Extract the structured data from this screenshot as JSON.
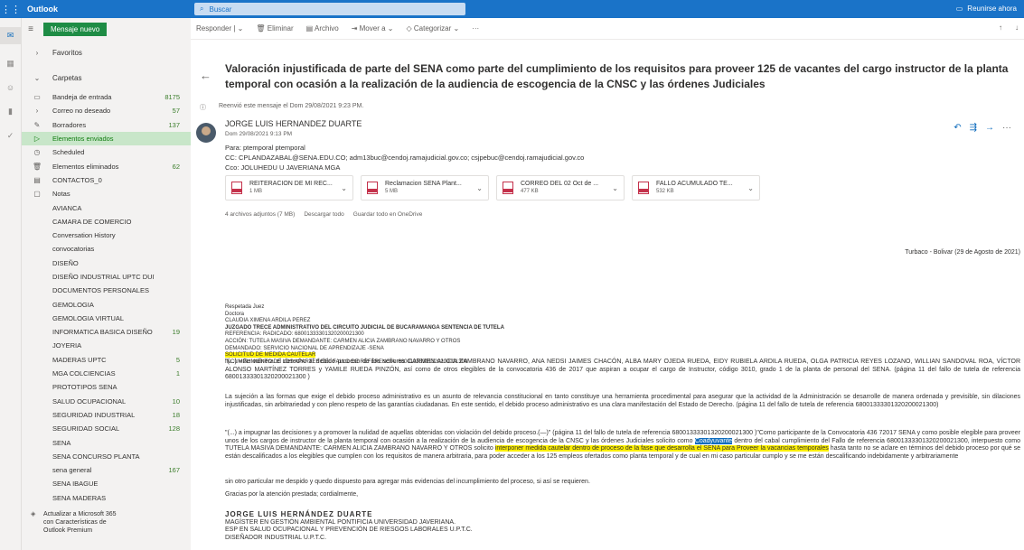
{
  "app": {
    "brand": "Outlook",
    "search_placeholder": "Buscar",
    "meet_now": "Reunirse ahora"
  },
  "folders": {
    "new_message": "Mensaje nuevo",
    "favorites": "Favoritos",
    "folders_label": "Carpetas",
    "items": [
      {
        "label": "Bandeja de entrada",
        "count": "8175",
        "icon": "inbox-icon"
      },
      {
        "label": "Correo no deseado",
        "count": "57",
        "icon": "chevron-right-icon"
      },
      {
        "label": "Borradores",
        "count": "137",
        "icon": "pencil-icon"
      },
      {
        "label": "Elementos enviados",
        "count": "",
        "icon": "send-icon"
      },
      {
        "label": "Scheduled",
        "count": "",
        "icon": "clock-icon"
      },
      {
        "label": "Elementos eliminados",
        "count": "62",
        "icon": "trash-icon"
      },
      {
        "label": "CONTACTOS_0",
        "count": "",
        "icon": "folder-icon"
      },
      {
        "label": "Notas",
        "count": "",
        "icon": "note-icon"
      },
      {
        "label": "AVIANCA",
        "count": ""
      },
      {
        "label": "CAMARA DE COMERCIO",
        "count": ""
      },
      {
        "label": "Conversation History",
        "count": ""
      },
      {
        "label": "convocatorias",
        "count": ""
      },
      {
        "label": "DISEÑO",
        "count": ""
      },
      {
        "label": "DISEÑO INDUSTRIAL UPTC DUITA...",
        "count": ""
      },
      {
        "label": "DOCUMENTOS PERSONALES",
        "count": ""
      },
      {
        "label": "GEMOLOGIA",
        "count": ""
      },
      {
        "label": "GEMOLOGIA VIRTUAL",
        "count": ""
      },
      {
        "label": "INFORMATICA BASICA DISEÑO ...",
        "count": "19"
      },
      {
        "label": "JOYERIA",
        "count": ""
      },
      {
        "label": "MADERAS UPTC",
        "count": "5"
      },
      {
        "label": "MGA COLCIENCIAS",
        "count": "1"
      },
      {
        "label": "PROTOTIPOS SENA",
        "count": ""
      },
      {
        "label": "SALUD OCUPACIONAL",
        "count": "10"
      },
      {
        "label": "SEGURIDAD INDUSTRIAL",
        "count": "18"
      },
      {
        "label": "SEGURIDAD SOCIAL",
        "count": "128"
      },
      {
        "label": "SENA",
        "count": ""
      },
      {
        "label": "SENA CONCURSO PLANTA",
        "count": ""
      },
      {
        "label": "sena general",
        "count": "167"
      },
      {
        "label": "SENA IBAGUE",
        "count": ""
      },
      {
        "label": "SENA MADERAS",
        "count": ""
      }
    ],
    "upgrade": [
      "Actualizar a Microsoft 365",
      "con Características de",
      "Outlook Premium"
    ]
  },
  "commands": {
    "reply": "Responder",
    "delete": "Eliminar",
    "archive": "Archivo",
    "move": "Mover a",
    "categorize": "Categorizar",
    "more": "···"
  },
  "message": {
    "subject": "Valoración injustificada de parte del SENA como parte del cumplimiento de los requisitos para proveer 125 de vacantes del cargo instructor de la planta temporal con ocasión a la realización de la audiencia de escogencia de la CNSC y las órdenes Judiciales",
    "forwarded_note": "Reenvió este mensaje el Dom 29/08/2021 9:23 PM.",
    "sender": "JORGE LUIS HERNANDEZ DUARTE",
    "date": "Dom 29/08/2021 9:13 PM",
    "to": "Para: ptemporal ptemporal",
    "cc": "CC: CPLANDAZABAL@SENA.EDU.CO; adm13buc@cendoj.ramajudicial.gov.co; csjpebuc@cendoj.ramajudicial.gov.co",
    "bcc": "Cco: JOLUHEDU U JAVERIANA MGA",
    "attachments": [
      {
        "name": "REITERACION DE MI REC...",
        "size": "1 MB"
      },
      {
        "name": "Reclamacion SENA Plant...",
        "size": "5 MB"
      },
      {
        "name": "CORREO DEL 02 Oct de ...",
        "size": "477 KB"
      },
      {
        "name": "FALLO ACUMULADO TE...",
        "size": "532 KB"
      }
    ],
    "attach_summary": "4 archivos adjuntos (7 MB)",
    "download_all": "Descargar todo",
    "save_onedrive": "Guardar todo en OneDrive",
    "place_date": "Turbaco - Bolivar (29 de Agosto de 2021)",
    "header_lines": [
      "Respetada Juez",
      "Doctora",
      "CLAUDIA XIMENA ARDILA PEREZ",
      "JUZGADO TRECE ADMINISTRATIVO DEL CIRCUITO JUDICIAL DE BUCARAMANGA SENTENCIA DE TUTELA",
      "REFERENCIA: RADICADO: 68001333301320200021300",
      "ACCIÓN: TUTELA MASIVA DEMANDANTE: CARMEN ALICIA ZAMBRANO NAVARRO Y OTROS",
      "DEMANDADO: SERVICIO NACIONAL DE APRENDIZAJE -SENA",
      "SOLICITUD DE MEDIDA CAUTELAR",
      "INCUMPLIMIENTO DE LOS APARTES DEL FALLO DE REFERENCIA: 68001333301320200021300"
    ],
    "para1": "\"(...) «Se vulnera el derecho al debido proceso de los señores CARMEN ALICIA ZAMBRANO NAVARRO, ANA NEDSI JAIMES CHACÓN, ALBA MARY OJEDA RUEDA, EIDY RUBIELA ARDILA RUEDA, OLGA PATRICIA REYES LOZANO, WILLIAN SANDOVAL ROA, VÍCTOR ALONSO MARTÍNEZ TORRES y YAMILE RUEDA PINZÓN, así como de otros elegibles de la convocatoria 436 de 2017 que aspiran a ocupar el cargo de Instructor, código 3010, grado 1 de la planta de personal del SENA. (página 11 del fallo de tutela de referencia 68001333301320200021300 )",
    "para2": "La sujeción a las formas que exige el debido proceso administrativo es un asunto de relevancia constitucional en tanto constituye una herramienta procedimental para asegurar que la actividad de la Administración se desarrolle de manera ordenada y previsible, sin dilaciones injustificadas, sin arbitrariedad y con pleno respeto de las garantías ciudadanas. En este sentido, el debido proceso administrativo es una clara manifestación del Estado de Derecho. (página 11 del fallo de tutela de referencia 68001333301320200021300)",
    "para3_a": "\"(...) a impugnar las decisiones y a promover la nulidad de aquellas obtenidas con violación del debido proceso.(—)\" (página 11 del fallo de tutela de referencia 68001333301320200021300 )\"Como participante de la Convocatoria 436 72017 SENA y como posible elegible para proveer unos de los cargos de instructor de la planta temporal con ocasión a la realización de la audiencia de escogencia de la CNSC y las órdenes Judiciales solicito como",
    "para3_hl_blue": "Coadyuvante",
    "para3_b": "dentro del cabal cumplimiento del Fallo de referencia 68001333301320200021300, interpuesto como TUTELA MASIVA DEMANDANTE: CARMEN ALICIA ZAMBRANO NAVARRO Y OTROS solicito",
    "para3_hl_yellow": "interponer medida cautelar dentro de proceso de la fase que desarrolla el SENA para Proveer la vacancias temporales",
    "para3_c": "hasta tanto no se aclare en términos del debido proceso por qué se están descalificados a los elegibles que cumplen con los requisitos de manera arbitraria, para poder acceder a los 125 empleos ofertados como planta temporal y de cual en mi caso particular cumplo y se me están descalificando indebidamente y arbitrariamente",
    "para4": "sin otro particular me despido y quedo dispuesto para agregar más evidencias del incumplimiento del proceso, si así se requieren.",
    "para5": "Gracias por la atención prestada; cordialmente,",
    "sig_name": "JORGE LUIS HERNÁNDEZ DUARTE",
    "sig_lines": [
      "MAGÍSTER EN GESTIÓN AMBIENTAL PONTIFICIA UNIVERSIDAD JAVERIANA.",
      "ESP EN SALUD OCUPACIONAL Y PREVENCIÓN DE RIESGOS LABORALES U.P.T.C.",
      "DISEÑADOR INDUSTRIAL U.P.T.C."
    ]
  }
}
